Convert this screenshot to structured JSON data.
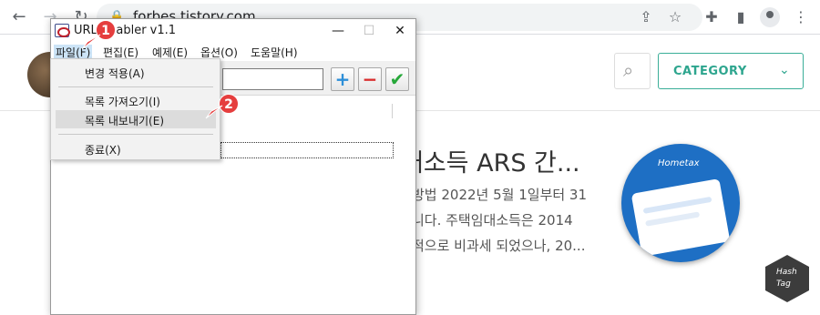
{
  "browser": {
    "url": "forbes.tistory.com",
    "icons": [
      "back-arrow-icon",
      "forward-arrow-icon",
      "reload-icon",
      "lock-icon",
      "share-icon",
      "bookmark-star-icon",
      "extensions-icon",
      "side-panel-icon",
      "profile-icon",
      "more-menu-icon"
    ]
  },
  "blog": {
    "category_label": "CATEGORY",
    "post_title": "대소득 ARS 간...",
    "post_lines": [
      "방법 2022년 5월 1일부터 31",
      "니다. 주택임대소득은 2014",
      "적으로 비과세 되었으나, 20..."
    ],
    "thumbnail_brand": "Hometax",
    "hash_badge": [
      "Hash",
      "Tag"
    ]
  },
  "app": {
    "title": "URL Enabler v1.1",
    "menu": [
      "파일(F)",
      "편집(E)",
      "예제(E)",
      "옵션(O)",
      "도움말(H)"
    ],
    "window_controls": [
      "—",
      "☐",
      "✕"
    ],
    "toolbar": {
      "add_symbol": "+",
      "remove_symbol": "−",
      "apply_symbol": "✔",
      "colors": {
        "add": "#2d8fd8",
        "remove": "#d92c2c",
        "apply": "#27a83a"
      }
    },
    "file_menu": {
      "items": [
        "변경 적용(A)",
        "목록 가져오기(I)",
        "목록 내보내기(E)",
        "종료(X)"
      ],
      "highlighted": "목록 내보내기(E)"
    }
  },
  "steps": [
    "1",
    "2"
  ],
  "colors": {
    "accent": "#2da58e",
    "step_badge": "#e53e3e"
  }
}
